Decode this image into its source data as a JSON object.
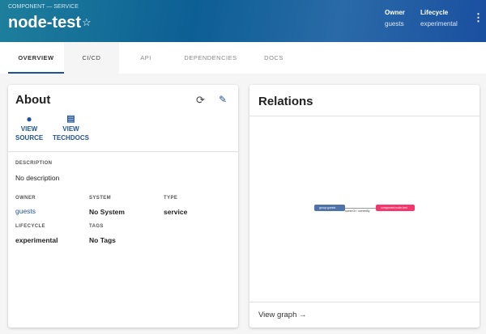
{
  "header": {
    "breadcrumb": "COMPONENT — SERVICE",
    "title": "node-test",
    "owner_label": "Owner",
    "owner_value": "guests",
    "lifecycle_label": "Lifecycle",
    "lifecycle_value": "experimental"
  },
  "tabs": [
    {
      "label": "OVERVIEW"
    },
    {
      "label": "CI/CD"
    },
    {
      "label": "API"
    },
    {
      "label": "DEPENDENCIES"
    },
    {
      "label": "DOCS"
    }
  ],
  "about": {
    "title": "About",
    "view_source": [
      "VIEW",
      "SOURCE"
    ],
    "view_techdocs": [
      "VIEW",
      "TECHDOCS"
    ],
    "description_label": "DESCRIPTION",
    "description": "No description",
    "owner_label": "OWNER",
    "owner": "guests",
    "system_label": "SYSTEM",
    "system": "No System",
    "type_label": "TYPE",
    "type": "service",
    "lifecycle_label": "LIFECYCLE",
    "lifecycle": "experimental",
    "tags_label": "TAGS",
    "tags": "No Tags"
  },
  "relations": {
    "title": "Relations",
    "node_a": "group:guests",
    "edge": "ownerOf / ownedBy",
    "node_b": "component:node-test",
    "view_graph": "View graph →"
  },
  "colors": {
    "accent": "#1f5493",
    "group_node": "#4f73a8",
    "component_node": "#f5356e"
  }
}
